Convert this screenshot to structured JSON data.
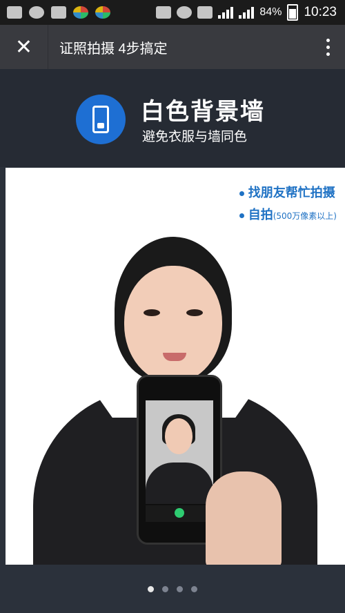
{
  "status_bar": {
    "battery": "84%",
    "time": "10:23"
  },
  "header": {
    "title": "证照拍摄 4步搞定"
  },
  "hero": {
    "title": "白色背景墙",
    "subtitle": "避免衣服与墙同色"
  },
  "tips": [
    {
      "label": "找朋友帮忙拍摄",
      "note": ""
    },
    {
      "label": "自拍",
      "note": "(500万像素以上)"
    }
  ],
  "pager": {
    "current": 1,
    "total": 4
  },
  "colors": {
    "accent": "#1f72c4",
    "hero_bg": "#262b34",
    "title_bar": "#393a3f"
  }
}
